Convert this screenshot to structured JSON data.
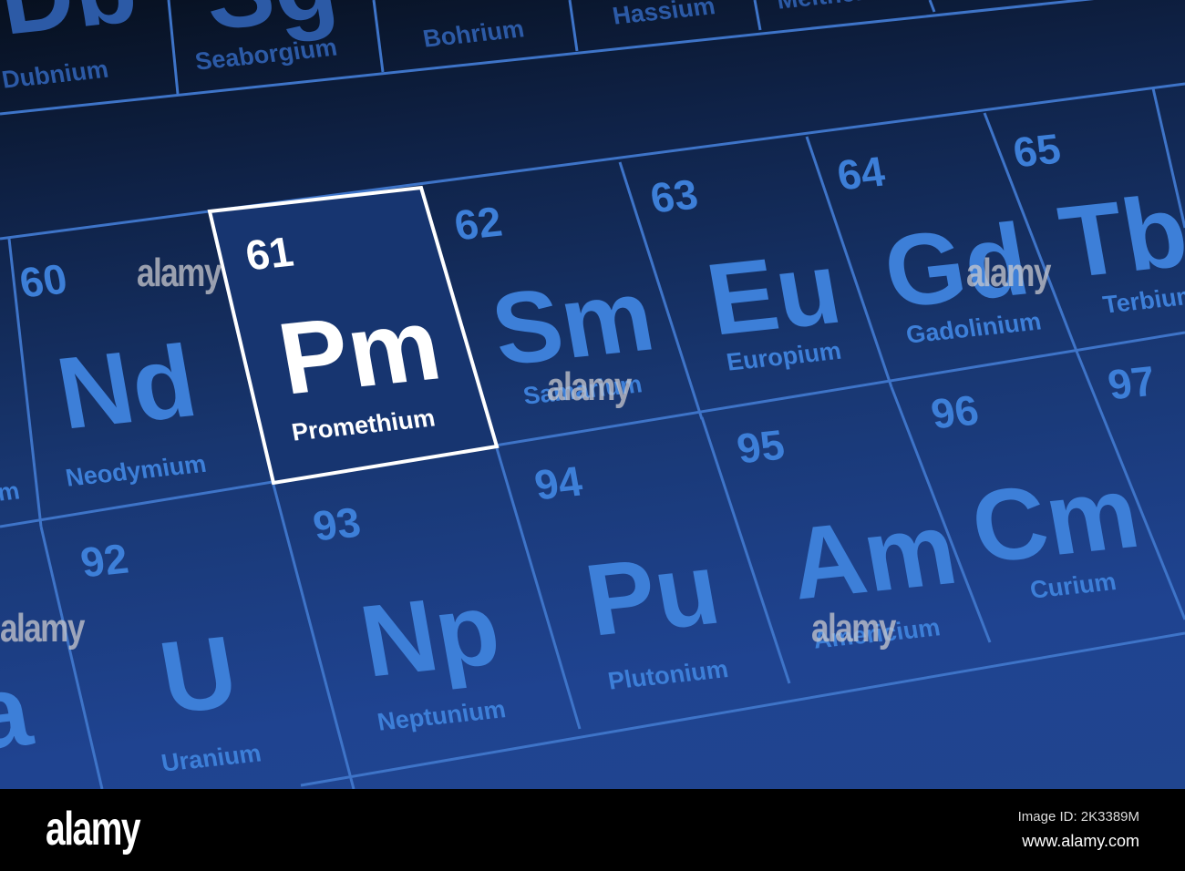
{
  "elements": [
    {
      "key": "db",
      "symbol": "Db",
      "name": "Dubnium"
    },
    {
      "key": "sg",
      "symbol": "Sg",
      "name": "Seaborgium"
    },
    {
      "key": "bh",
      "name": "Bohrium"
    },
    {
      "key": "hs",
      "name": "Hassium"
    },
    {
      "key": "mt",
      "name": "Meitnerium"
    },
    {
      "key": "nd",
      "number": "60",
      "symbol": "Nd",
      "name": "Neodymium"
    },
    {
      "key": "pm",
      "number": "61",
      "symbol": "Pm",
      "name": "Promethium",
      "selected": true
    },
    {
      "key": "sm",
      "number": "62",
      "symbol": "Sm",
      "name": "Samarium"
    },
    {
      "key": "eu",
      "number": "63",
      "symbol": "Eu",
      "name": "Europium"
    },
    {
      "key": "gd",
      "number": "64",
      "symbol": "Gd",
      "name": "Gadolinium"
    },
    {
      "key": "tb",
      "number": "65",
      "symbol": "Tb",
      "name": "Terbium"
    },
    {
      "key": "u",
      "number": "92",
      "symbol": "U",
      "name": "Uranium"
    },
    {
      "key": "np",
      "number": "93",
      "symbol": "Np",
      "name": "Neptunium"
    },
    {
      "key": "pu",
      "number": "94",
      "symbol": "Pu",
      "name": "Plutonium"
    },
    {
      "key": "am",
      "number": "95",
      "symbol": "Am",
      "name": "Americium"
    },
    {
      "key": "cm",
      "number": "96",
      "symbol": "Cm",
      "name": "Curium"
    },
    {
      "key": "bk",
      "number": "97"
    },
    {
      "key": "pr",
      "name": "m"
    },
    {
      "key": "pa",
      "symbol": "a"
    }
  ],
  "watermark": "alamy",
  "footer": {
    "logo": "alamy",
    "image_id": "Image ID: 2K3389M",
    "url": "www.alamy.com"
  },
  "colors": {
    "text": "#3d7fd8",
    "line": "#3e74c8",
    "selected": "#ffffff"
  }
}
